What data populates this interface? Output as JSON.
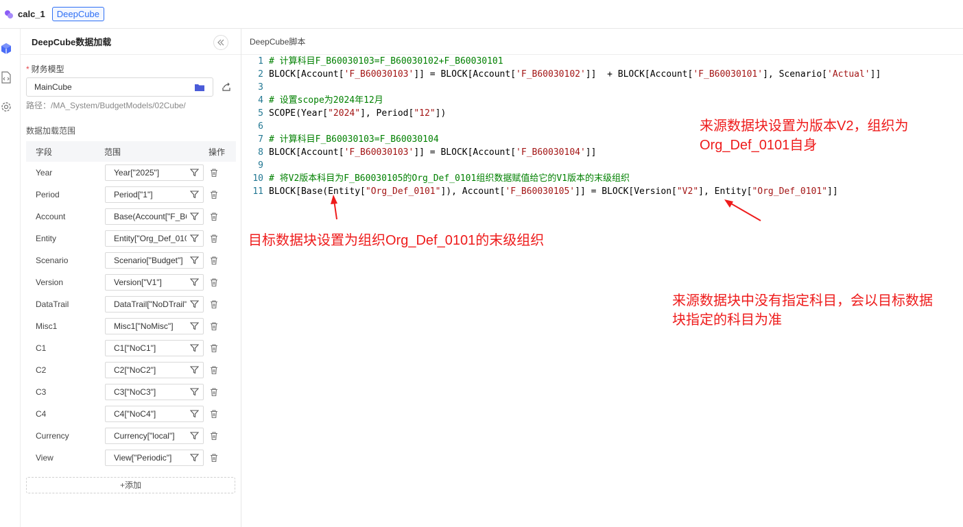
{
  "app": {
    "title": "calc_1",
    "tag": "DeepCube"
  },
  "panel": {
    "title": "DeepCube数据加载",
    "model_label": "财务模型",
    "model_required_mark": "*",
    "model_value": "MainCube",
    "path": "路径：/MA_System/BudgetModels/02Cube/",
    "section_title": "数据加载范围",
    "columns": [
      "字段",
      "范围",
      "操作"
    ],
    "rows": [
      {
        "name": "Year",
        "value": "Year[\"2025\"]"
      },
      {
        "name": "Period",
        "value": "Period[\"1\"]"
      },
      {
        "name": "Account",
        "value": "Base(Account[\"F_B6"
      },
      {
        "name": "Entity",
        "value": "Entity[\"Org_Def_010"
      },
      {
        "name": "Scenario",
        "value": "Scenario[\"Budget\"]"
      },
      {
        "name": "Version",
        "value": "Version[\"V1\"]"
      },
      {
        "name": "DataTrail",
        "value": "DataTrail[\"NoDTrail\""
      },
      {
        "name": "Misc1",
        "value": "Misc1[\"NoMisc\"]"
      },
      {
        "name": "C1",
        "value": "C1[\"NoC1\"]"
      },
      {
        "name": "C2",
        "value": "C2[\"NoC2\"]"
      },
      {
        "name": "C3",
        "value": "C3[\"NoC3\"]"
      },
      {
        "name": "C4",
        "value": "C4[\"NoC4\"]"
      },
      {
        "name": "Currency",
        "value": "Currency[\"local\"]"
      },
      {
        "name": "View",
        "value": "View[\"Periodic\"]"
      }
    ],
    "add_label": "+添加"
  },
  "editor": {
    "title": "DeepCube脚本",
    "lines": [
      [
        {
          "t": "# 计算科目F_B60030103=F_B60030102+F_B60030101",
          "c": "cm"
        }
      ],
      [
        {
          "t": "BLOCK[Account[",
          "c": ""
        },
        {
          "t": "'F_B60030103'",
          "c": "str"
        },
        {
          "t": "]] = BLOCK[Account[",
          "c": ""
        },
        {
          "t": "'F_B60030102'",
          "c": "str"
        },
        {
          "t": "]]  + BLOCK[Account[",
          "c": ""
        },
        {
          "t": "'F_B60030101'",
          "c": "str"
        },
        {
          "t": "], Scenario[",
          "c": ""
        },
        {
          "t": "'Actual'",
          "c": "str"
        },
        {
          "t": "]]",
          "c": ""
        }
      ],
      [],
      [
        {
          "t": "# 设置scope为2024年12月",
          "c": "cm"
        }
      ],
      [
        {
          "t": "SCOPE(Year[",
          "c": ""
        },
        {
          "t": "\"2024\"",
          "c": "str"
        },
        {
          "t": "], Period[",
          "c": ""
        },
        {
          "t": "\"12\"",
          "c": "str"
        },
        {
          "t": "])",
          "c": ""
        }
      ],
      [],
      [
        {
          "t": "# 计算科目F_B60030103=F_B60030104",
          "c": "cm"
        }
      ],
      [
        {
          "t": "BLOCK[Account[",
          "c": ""
        },
        {
          "t": "'F_B60030103'",
          "c": "str"
        },
        {
          "t": "]] = BLOCK[Account[",
          "c": ""
        },
        {
          "t": "'F_B60030104'",
          "c": "str"
        },
        {
          "t": "]]",
          "c": ""
        }
      ],
      [],
      [
        {
          "t": "# 将V2版本科目为F_B60030105的Org_Def_0101组织数据赋值给它的V1版本的末级组织",
          "c": "cm"
        }
      ],
      [
        {
          "t": "BLOCK[Base(Entity[",
          "c": ""
        },
        {
          "t": "\"Org_Def_0101\"",
          "c": "str"
        },
        {
          "t": "]), Account[",
          "c": ""
        },
        {
          "t": "'F_B60030105'",
          "c": "str"
        },
        {
          "t": "]] = BLOCK[Version[",
          "c": ""
        },
        {
          "t": "\"V2\"",
          "c": "str"
        },
        {
          "t": "], Entity[",
          "c": ""
        },
        {
          "t": "\"Org_Def_0101\"",
          "c": "str"
        },
        {
          "t": "]]",
          "c": ""
        }
      ]
    ]
  },
  "annotations": {
    "source_version": [
      "来源数据块设置为版本V2，组织为",
      "Org_Def_0101自身"
    ],
    "target_entity": "目标数据块设置为组织Org_Def_0101的末级组织",
    "source_account": [
      "来源数据块中没有指定科目，会以目标数据",
      "块指定的科目为准"
    ]
  },
  "colors": {
    "accent": "#2e6ff5",
    "annotation": "#ee1b1b",
    "comment": "#008000",
    "string": "#a31515"
  }
}
